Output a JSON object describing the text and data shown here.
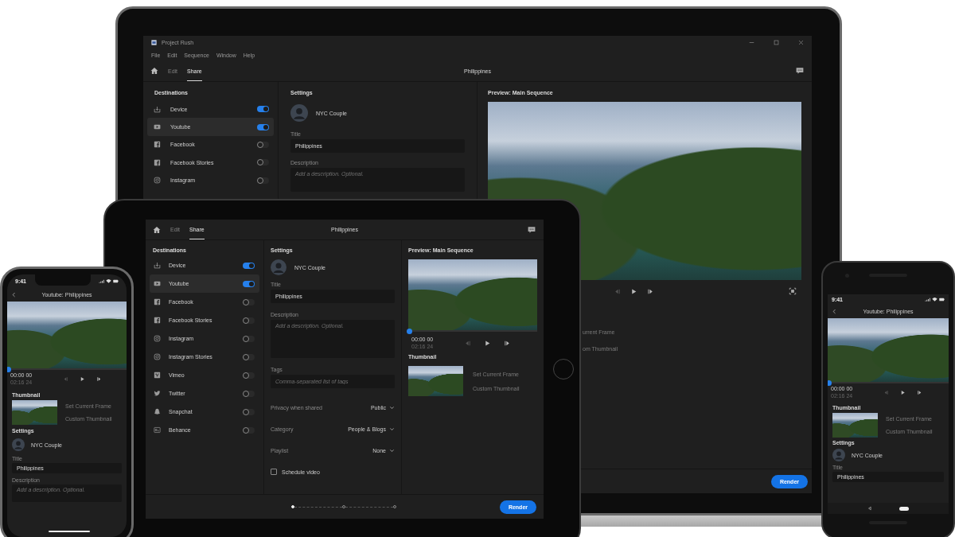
{
  "laptop": {
    "window": {
      "title": "Project Rush",
      "menu": [
        "File",
        "Edit",
        "Sequence",
        "Window",
        "Help"
      ]
    },
    "nav": {
      "tabs": [
        {
          "label": "Edit",
          "selected": false
        },
        {
          "label": "Share",
          "selected": true
        }
      ],
      "title": "Philippines"
    },
    "destinations": {
      "heading": "Destinations",
      "items": [
        {
          "label": "Device",
          "kind": "device",
          "on": true,
          "selected": false
        },
        {
          "label": "Youtube",
          "kind": "youtube",
          "on": true,
          "selected": true
        },
        {
          "label": "Facebook",
          "kind": "facebook",
          "on": false,
          "selected": false
        },
        {
          "label": "Facebook Stories",
          "kind": "facebook",
          "on": false,
          "selected": false
        },
        {
          "label": "Instagram",
          "kind": "instagram",
          "on": false,
          "selected": false
        }
      ]
    },
    "settings": {
      "heading": "Settings",
      "account": "NYC Couple",
      "fields": [
        {
          "kind": "text",
          "label": "Title",
          "value": "Philippines"
        },
        {
          "kind": "textarea",
          "label": "Description",
          "placeholder": "Add a description. Optional."
        }
      ]
    },
    "preview": {
      "heading": "Preview: Main Sequence",
      "thumbnail_options": [
        "urrent Frame",
        "om Thumbnail"
      ]
    },
    "render": "Render"
  },
  "tablet": {
    "nav": {
      "tabs": [
        {
          "label": "Edit",
          "selected": false
        },
        {
          "label": "Share",
          "selected": true
        }
      ],
      "title": "Philippines"
    },
    "destinations": {
      "heading": "Destinations",
      "items": [
        {
          "label": "Device",
          "kind": "device",
          "on": true,
          "selected": false
        },
        {
          "label": "Youtube",
          "kind": "youtube",
          "on": true,
          "selected": true
        },
        {
          "label": "Facebook",
          "kind": "facebook",
          "on": false,
          "selected": false
        },
        {
          "label": "Facebook Stories",
          "kind": "facebook",
          "on": false,
          "selected": false
        },
        {
          "label": "Instagram",
          "kind": "instagram",
          "on": false,
          "selected": false
        },
        {
          "label": "Instagram Stories",
          "kind": "instagram",
          "on": false,
          "selected": false
        },
        {
          "label": "Vimeo",
          "kind": "vimeo",
          "on": false,
          "selected": false
        },
        {
          "label": "Twitter",
          "kind": "twitter",
          "on": false,
          "selected": false
        },
        {
          "label": "Snapchat",
          "kind": "snapchat",
          "on": false,
          "selected": false
        },
        {
          "label": "Behance",
          "kind": "behance",
          "on": false,
          "selected": false
        }
      ]
    },
    "settings": {
      "heading": "Settings",
      "account": "NYC Couple",
      "fields": [
        {
          "kind": "text",
          "label": "Title",
          "value": "Philippines"
        },
        {
          "kind": "textarea",
          "label": "Description",
          "placeholder": "Add a description. Optional."
        },
        {
          "kind": "text",
          "label": "Tags",
          "placeholder": "Comma-separated list of tags"
        }
      ],
      "selects": [
        {
          "label": "Privacy when shared",
          "value": "Public"
        },
        {
          "label": "Category",
          "value": "People & Blogs"
        },
        {
          "label": "Playlist",
          "value": "None"
        }
      ],
      "schedule": {
        "label": "Schedule video",
        "checked": false
      }
    },
    "preview": {
      "heading": "Preview: Main Sequence",
      "playhead": {
        "level": 0
      },
      "time": {
        "current": "00:00",
        "current_frames": "00",
        "duration": "02:16",
        "duration_frames": "24"
      },
      "thumbnail": {
        "heading": "Thumbnail",
        "options": [
          "Set Current Frame",
          "Custom Thumbnail"
        ]
      }
    },
    "steps": [
      {
        "selected": true
      },
      {
        "selected": false
      },
      {
        "selected": false
      }
    ],
    "render": "Render"
  },
  "phone_left": {
    "status_time": "9:41",
    "title": "Youtube: Philippines",
    "playhead": {
      "level": 0
    },
    "time": {
      "current": "00:00",
      "current_frames": "00",
      "duration": "02:16",
      "duration_frames": "24"
    },
    "thumbnail": {
      "heading": "Thumbnail",
      "options": [
        "Set Current Frame",
        "Custom Thumbnail"
      ]
    },
    "settings": {
      "heading": "Settings",
      "account": "NYC Couple",
      "fields": [
        {
          "kind": "text",
          "label": "Title",
          "value": "Philippines"
        },
        {
          "kind": "textarea",
          "label": "Description",
          "placeholder": "Add a description. Optional."
        }
      ]
    }
  },
  "phone_right": {
    "status_time": "9:41",
    "title": "Youtube: Philippines",
    "playhead": {
      "level": 0
    },
    "time": {
      "current": "00:00",
      "current_frames": "00",
      "duration": "02:16",
      "duration_frames": "24"
    },
    "thumbnail": {
      "heading": "Thumbnail",
      "options": [
        "Set Current Frame",
        "Custom Thumbnail"
      ]
    },
    "settings": {
      "heading": "Settings",
      "account": "NYC Couple",
      "fields": [
        {
          "kind": "text",
          "label": "Title",
          "value": "Philippines"
        }
      ]
    }
  }
}
